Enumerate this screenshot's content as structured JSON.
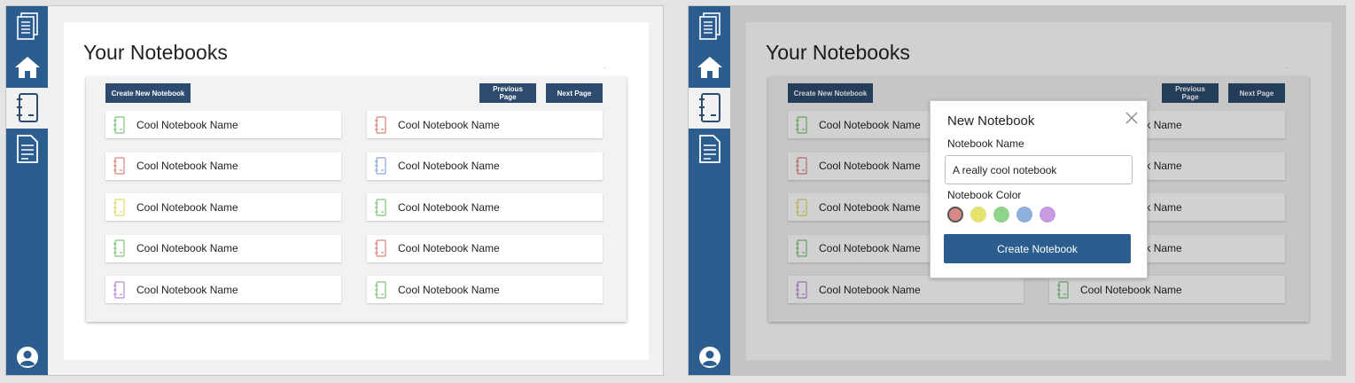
{
  "sidebar": {
    "items": [
      {
        "icon": "notebooks-stack-icon"
      },
      {
        "icon": "home-icon"
      },
      {
        "icon": "notebook-icon"
      },
      {
        "icon": "document-icon"
      }
    ],
    "user_icon": "user-account-icon",
    "colors": {
      "background": "#2c5d8f",
      "active": "#f1f1f1"
    }
  },
  "page": {
    "title": "Your Notebooks",
    "corner_mark": "."
  },
  "toolbar": {
    "create_label": "Create New Notebook",
    "prev_label": "Previous Page",
    "next_label": "Next Page"
  },
  "notebooks": {
    "left": [
      {
        "name": "Cool Notebook Name",
        "color": "#7ec47a"
      },
      {
        "name": "Cool Notebook Name",
        "color": "#d9837c"
      },
      {
        "name": "Cool Notebook Name",
        "color": "#dcdc66"
      },
      {
        "name": "Cool Notebook Name",
        "color": "#7ec47a"
      },
      {
        "name": "Cool Notebook Name",
        "color": "#b98ad6"
      }
    ],
    "right": [
      {
        "name": "Cool Notebook Name",
        "color": "#d9837c"
      },
      {
        "name": "Cool Notebook Name",
        "color": "#86a8d6"
      },
      {
        "name": "Cool Notebook Name",
        "color": "#7ec47a"
      },
      {
        "name": "Cool Notebook Name",
        "color": "#d9837c"
      },
      {
        "name": "Cool Notebook Name",
        "color": "#7ec47a"
      }
    ]
  },
  "modal": {
    "title": "New Notebook",
    "name_label": "Notebook Name",
    "name_value": "A really cool notebook",
    "color_label": "Notebook Color",
    "colors": [
      "#d98a86",
      "#e6e26e",
      "#8fd48b",
      "#8fb0dc",
      "#c79be2"
    ],
    "selected_color": 0,
    "submit_label": "Create Notebook"
  }
}
